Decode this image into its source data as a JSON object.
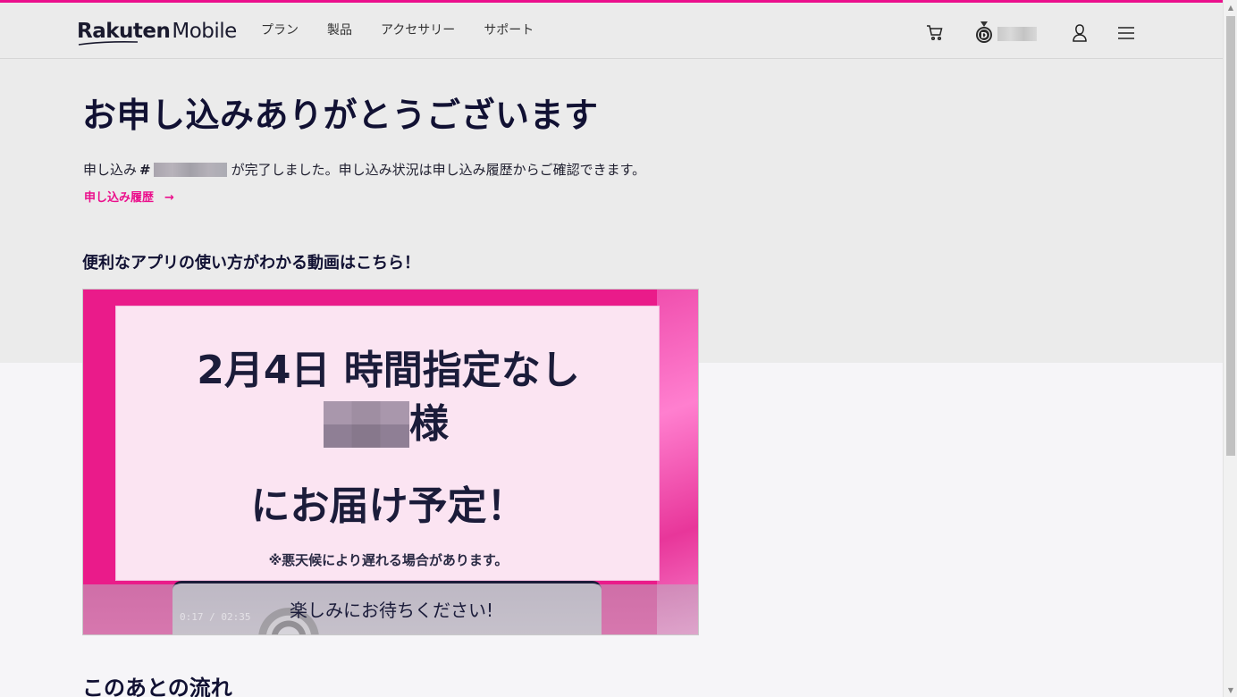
{
  "header": {
    "logo_brand": "Rakuten",
    "logo_product": "Mobile",
    "nav": [
      "プラン",
      "製品",
      "アクセサリー",
      "サポート"
    ],
    "icons": [
      "cart-icon",
      "medal-icon",
      "account-icon",
      "menu-icon"
    ]
  },
  "main": {
    "title": "お申し込みありがとうございます",
    "order_prefix": "申し込み",
    "order_hash": "#",
    "status_suffix": "が完了しました。申し込み状況は申し込み履歴からご確認できます。",
    "history_link": "申し込み履歴",
    "history_arrow": "→",
    "video_heading": "便利なアプリの使い方がわかる動画はこちら！",
    "next_heading": "このあとの流れ"
  },
  "video": {
    "line1": "2月4日 時間指定なし",
    "honorific": "様",
    "line3": "にお届け予定！",
    "note": "※悪天候により遅れる場合があります。",
    "caption": "楽しみにお待ちください!",
    "time": "0:17 / 02:35"
  },
  "colors": {
    "accent": "#eb0f8c",
    "band": "#ebebeb",
    "background": "#f6f5f8",
    "text": "#111133"
  }
}
